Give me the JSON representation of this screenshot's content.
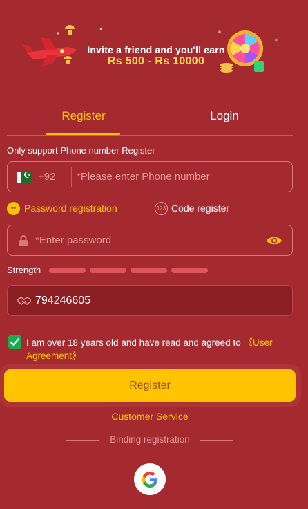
{
  "banner": {
    "line1": "Invite a friend and you'll earn",
    "line2": "Rs 500 - Rs 10000"
  },
  "tabs": {
    "register": "Register",
    "login": "Login"
  },
  "phone": {
    "hint": "Only support Phone number Register",
    "country_code": "+92",
    "required_mark": "*",
    "placeholder": "Please enter Phone number"
  },
  "register_modes": {
    "password": "Password registration",
    "code": "Code register",
    "code_icon_text": "123"
  },
  "password": {
    "required_mark": "*",
    "placeholder": "Enter password"
  },
  "strength": {
    "label": "Strength",
    "filled_segments": 0,
    "total_segments": 4
  },
  "invite_code": {
    "value": "794246605"
  },
  "agreement": {
    "checked": true,
    "text": "I am over 18 years old and have read and agreed to ",
    "link": "《User Agreement》"
  },
  "register_button": "Register",
  "customer_service": "Customer Service",
  "binding_label": "Binding registration",
  "icons": {
    "lock": "lock-icon",
    "eye": "eye-icon",
    "handshake": "handshake-icon",
    "google": "google-icon"
  },
  "colors": {
    "background": "#a52a2f",
    "accent": "#ffc400",
    "check": "#13b14b"
  }
}
